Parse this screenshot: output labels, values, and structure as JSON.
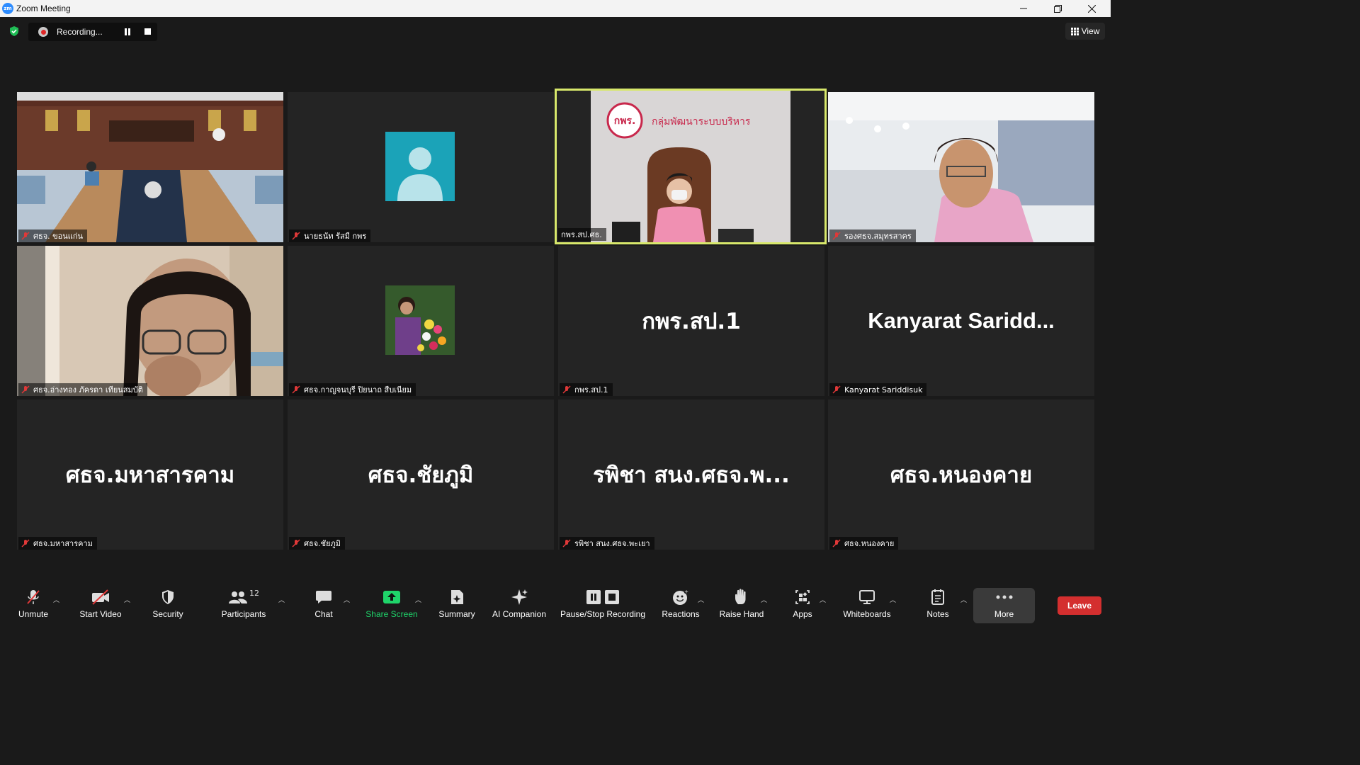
{
  "window": {
    "title": "Zoom Meeting",
    "logo_text": "zm"
  },
  "recording": {
    "label": "Recording..."
  },
  "view_button": {
    "label": "View"
  },
  "tiles": [
    {
      "label": "ศธจ. ขอนแก่น",
      "type": "video"
    },
    {
      "label": "นายธนัท รัสมี กพร",
      "type": "avatar"
    },
    {
      "label": "กพร.สป.ศธ.",
      "type": "video",
      "active": true
    },
    {
      "label": "รองศธจ.สมุทรสาคร",
      "type": "video"
    },
    {
      "label": "ศธจ.อ่างทอง ภัครดา เทียนสมบัติ",
      "type": "video"
    },
    {
      "label": "ศธจ.กาญจนบุรี ปิยนาถ สืบเนียม",
      "type": "photo"
    },
    {
      "label": "กพร.สป.1",
      "type": "name",
      "display_name": "กพร.สป.1"
    },
    {
      "label": "Kanyarat Sariddisuk",
      "type": "name",
      "display_name": "Kanyarat  Saridd..."
    },
    {
      "label": "ศธจ.มหาสารคาม",
      "type": "name",
      "display_name": "ศธจ.มหาสารคาม"
    },
    {
      "label": "ศธจ.ชัยภูมิ",
      "type": "name",
      "display_name": "ศธจ.ชัยภูมิ"
    },
    {
      "label": "รพิชา สนง.ศธจ.พะเยา",
      "type": "name",
      "display_name": "รพิชา สนง.ศธจ.พ..."
    },
    {
      "label": "ศธจ.หนองคาย",
      "type": "name",
      "display_name": "ศธจ.หนองคาย"
    }
  ],
  "video_text": {
    "logo_text": "กพร.",
    "banner_text": "กลุ่มพัฒนาระบบบริหาร"
  },
  "toolbar": {
    "unmute": "Unmute",
    "start_video": "Start Video",
    "security": "Security",
    "participants": "Participants",
    "participants_count": "12",
    "chat": "Chat",
    "share_screen": "Share Screen",
    "summary": "Summary",
    "ai_companion": "AI Companion",
    "pause_stop_recording": "Pause/Stop Recording",
    "reactions": "Reactions",
    "raise_hand": "Raise Hand",
    "apps": "Apps",
    "whiteboards": "Whiteboards",
    "notes": "Notes",
    "more": "More",
    "leave": "Leave"
  },
  "colors": {
    "share_green": "#1fd46a",
    "leave_red": "#d42f2f",
    "active_speaker": "#d8e86b",
    "avatar_teal": "#1ba3b8"
  }
}
